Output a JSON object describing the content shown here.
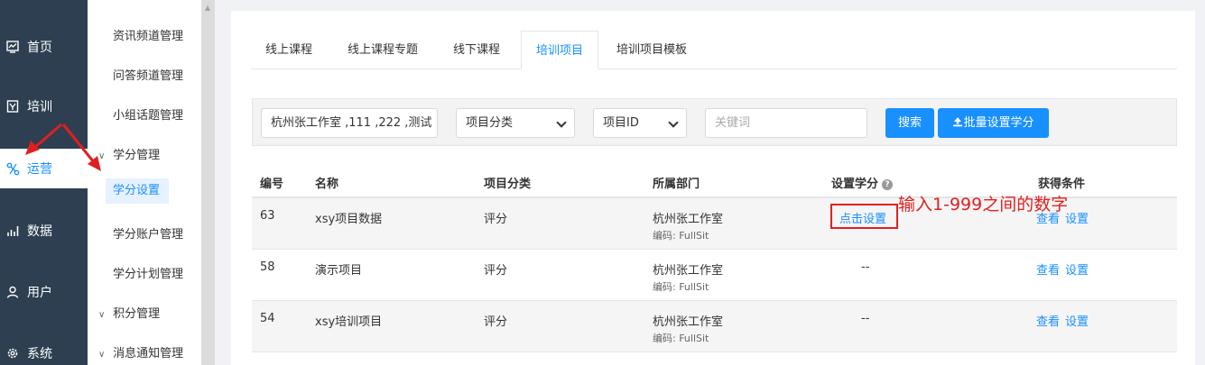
{
  "nav_primary": [
    {
      "label": "首页",
      "icon": "dashboard-icon"
    },
    {
      "label": "培训",
      "icon": "book-icon"
    },
    {
      "label": "运营",
      "icon": "operations-icon",
      "active": true
    },
    {
      "label": "数据",
      "icon": "bar-chart-icon"
    },
    {
      "label": "用户",
      "icon": "user-icon"
    },
    {
      "label": "系统",
      "icon": "gear-icon"
    }
  ],
  "nav_secondary": {
    "items_top": [
      "资讯频道管理",
      "问答频道管理",
      "小组话题管理"
    ],
    "group_credit": "学分管理",
    "credit_items": [
      "学分设置",
      "学分账户管理",
      "学分计划管理"
    ],
    "group_points": "积分管理",
    "group_notify": "消息通知管理"
  },
  "tabs": [
    "线上课程",
    "线上课程专题",
    "线下课程",
    "培训项目",
    "培训项目模板"
  ],
  "active_tab": "培训项目",
  "filter": {
    "dept_value": "杭州张工作室 ,111 ,222 ,测试",
    "category_select": "项目分类",
    "id_select": "项目ID",
    "keyword_placeholder": "关键词",
    "search_button": "搜索",
    "batch_button": "批量设置学分"
  },
  "table": {
    "headers": [
      "编号",
      "名称",
      "项目分类",
      "所属部门",
      "设置学分",
      "获得条件"
    ],
    "rows": [
      {
        "id": "63",
        "name": "xsy项目数据",
        "category": "评分",
        "dept": "杭州张工作室",
        "code": "编码: FullSit",
        "credit": "点击设置",
        "view": "查看",
        "set": "设置"
      },
      {
        "id": "58",
        "name": "演示项目",
        "category": "评分",
        "dept": "杭州张工作室",
        "code": "编码: FullSit",
        "credit": "--",
        "view": "查看",
        "set": "设置"
      },
      {
        "id": "54",
        "name": "xsy培训项目",
        "category": "评分",
        "dept": "杭州张工作室",
        "code": "编码: FullSit",
        "credit": "--",
        "view": "查看",
        "set": "设置"
      }
    ]
  },
  "annotation": "输入1-999之间的数字",
  "colors": {
    "sidebar": "#2d3f51",
    "accent": "#1890ff",
    "annotation": "#e02020"
  }
}
